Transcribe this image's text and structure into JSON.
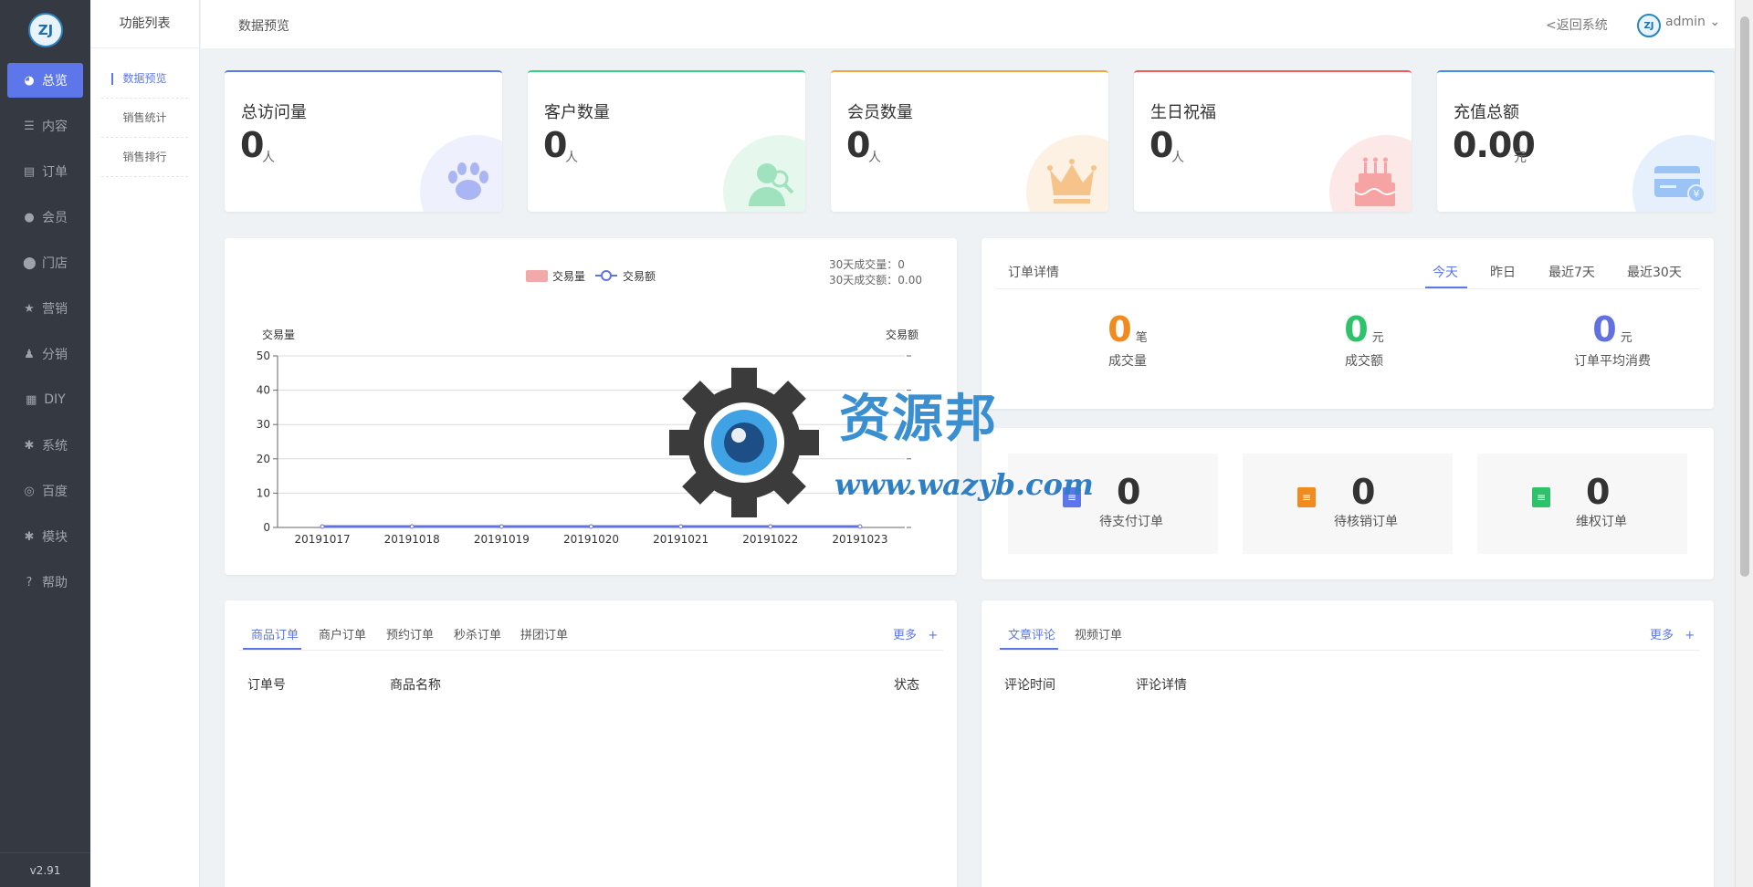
{
  "app": {
    "version": "v2.91",
    "logo_text": "ZJ"
  },
  "sidebar": {
    "items": [
      {
        "label": "总览",
        "icon": "pie-chart-icon",
        "active": true
      },
      {
        "label": "内容",
        "icon": "list-icon"
      },
      {
        "label": "订单",
        "icon": "document-icon"
      },
      {
        "label": "会员",
        "icon": "user-icon"
      },
      {
        "label": "门店",
        "icon": "map-pin-icon"
      },
      {
        "label": "营销",
        "icon": "star-icon"
      },
      {
        "label": "分销",
        "icon": "users-icon"
      },
      {
        "label": "DIY",
        "icon": "layout-icon"
      },
      {
        "label": "系统",
        "icon": "gear-icon"
      },
      {
        "label": "百度",
        "icon": "compass-icon"
      },
      {
        "label": "模块",
        "icon": "gear-icon"
      },
      {
        "label": "帮助",
        "icon": "help-icon"
      }
    ]
  },
  "subnav": {
    "title": "功能列表",
    "items": [
      {
        "label": "数据预览",
        "active": true
      },
      {
        "label": "销售统计"
      },
      {
        "label": "销售排行"
      }
    ]
  },
  "topbar": {
    "page_title": "数据预览",
    "back_link": "<返回系统",
    "user": "admin",
    "user_caret": "⌄"
  },
  "stats": [
    {
      "label": "总访问量",
      "value": "0",
      "unit": "人",
      "color": "#5d76e9",
      "icon": "paw-icon"
    },
    {
      "label": "客户数量",
      "value": "0",
      "unit": "人",
      "color": "#36cf86",
      "icon": "customers-icon"
    },
    {
      "label": "会员数量",
      "value": "0",
      "unit": "人",
      "color": "#f4a341",
      "icon": "crown-icon"
    },
    {
      "label": "生日祝福",
      "value": "0",
      "unit": "人",
      "color": "#f15a5a",
      "icon": "cake-icon"
    },
    {
      "label": "充值总额",
      "value": "0.00",
      "unit": "元",
      "color": "#3f8ef0",
      "icon": "card-icon"
    }
  ],
  "chart": {
    "summary_count": "30天成交量：0",
    "summary_amount": "30天成交额：0.00"
  },
  "chart_data": {
    "type": "bar",
    "categories": [
      "20191017",
      "20191018",
      "20191019",
      "20191020",
      "20191021",
      "20191022",
      "20191023"
    ],
    "series": [
      {
        "name": "交易量",
        "type": "bar",
        "values": [
          0,
          0,
          0,
          0,
          0,
          0,
          0
        ],
        "color": "#f1a9a9"
      },
      {
        "name": "交易额",
        "type": "line",
        "values": [
          0,
          0,
          0,
          0,
          0,
          0,
          0
        ],
        "color": "#6271e0"
      }
    ],
    "ylabel": "交易量",
    "ylabel_right": "交易额",
    "ylim": [
      0,
      50
    ],
    "yticks": [
      0,
      10,
      20,
      30,
      40,
      50
    ],
    "grid": true,
    "legend": "top"
  },
  "order_details": {
    "title": "订单详情",
    "tabs": [
      "今天",
      "昨日",
      "最近7天",
      "最近30天"
    ],
    "active_tab": 0,
    "metrics": [
      {
        "value": "0",
        "unit": "笔",
        "label": "成交量",
        "color": "#f08c1f"
      },
      {
        "value": "0",
        "unit": "元",
        "label": "成交额",
        "color": "#2ec26b"
      },
      {
        "value": "0",
        "unit": "元",
        "label": "订单平均消费",
        "color": "#6271e0"
      }
    ]
  },
  "pending": [
    {
      "value": "0",
      "label": "待支付订单",
      "color": "#5d76e9",
      "icon": "pay-order-icon"
    },
    {
      "value": "0",
      "label": "待核销订单",
      "color": "#f08c1f",
      "icon": "verify-order-icon"
    },
    {
      "value": "0",
      "label": "维权订单",
      "color": "#2ec26b",
      "icon": "rights-order-icon"
    }
  ],
  "orders_panel": {
    "tabs": [
      "商品订单",
      "商户订单",
      "预约订单",
      "秒杀订单",
      "拼团订单"
    ],
    "more": "更多",
    "plus": "+",
    "columns": [
      "订单号",
      "商品名称",
      "状态"
    ]
  },
  "comments_panel": {
    "tabs": [
      "文章评论",
      "视频订单"
    ],
    "more": "更多",
    "plus": "+",
    "columns": [
      "评论时间",
      "评论详情"
    ]
  },
  "watermark": {
    "title": "资源邦",
    "url": "www.wazyb.com"
  }
}
